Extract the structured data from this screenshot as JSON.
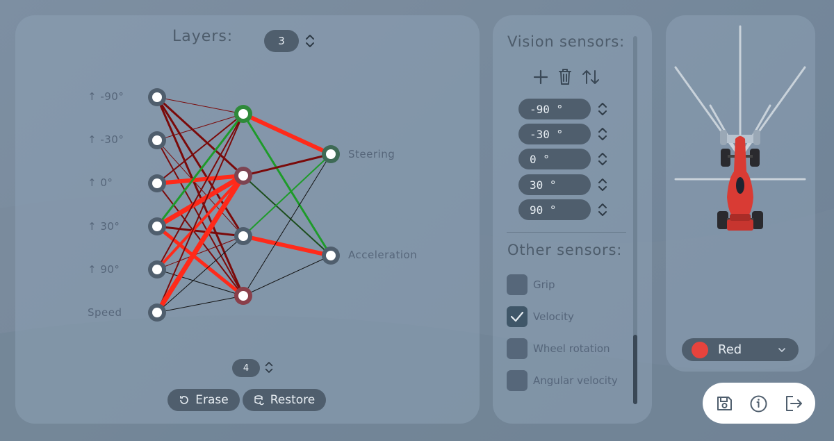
{
  "network": {
    "layers_label": "Layers:",
    "layers_value": "3",
    "hidden_count": "4",
    "erase_label": "Erase",
    "restore_label": "Restore",
    "inputs": [
      "↑ -90°",
      "↑ -30°",
      "↑ 0°",
      "↑ 30°",
      "↑ 90°",
      "Speed"
    ],
    "outputs": [
      "Steering",
      "Acceleration"
    ],
    "colors": {
      "positive": "#1e9b2a",
      "negative": "#ff2a1a",
      "dark_negative": "#7a0a0a",
      "node": "#4f5e6d"
    }
  },
  "vision_sensors": {
    "title": "Vision sensors:",
    "angles": [
      "-90 °",
      "-30 °",
      "0 °",
      "30 °",
      "90 °"
    ]
  },
  "other_sensors": {
    "title": "Other sensors:",
    "items": [
      {
        "label": "Grip",
        "checked": false
      },
      {
        "label": "Velocity",
        "checked": true
      },
      {
        "label": "Wheel rotation",
        "checked": false
      },
      {
        "label": "Angular velocity",
        "checked": false
      }
    ]
  },
  "car": {
    "color_label": "Red",
    "color_hex": "#e8433d"
  },
  "actions": [
    "save-icon",
    "info-icon",
    "exit-icon"
  ]
}
